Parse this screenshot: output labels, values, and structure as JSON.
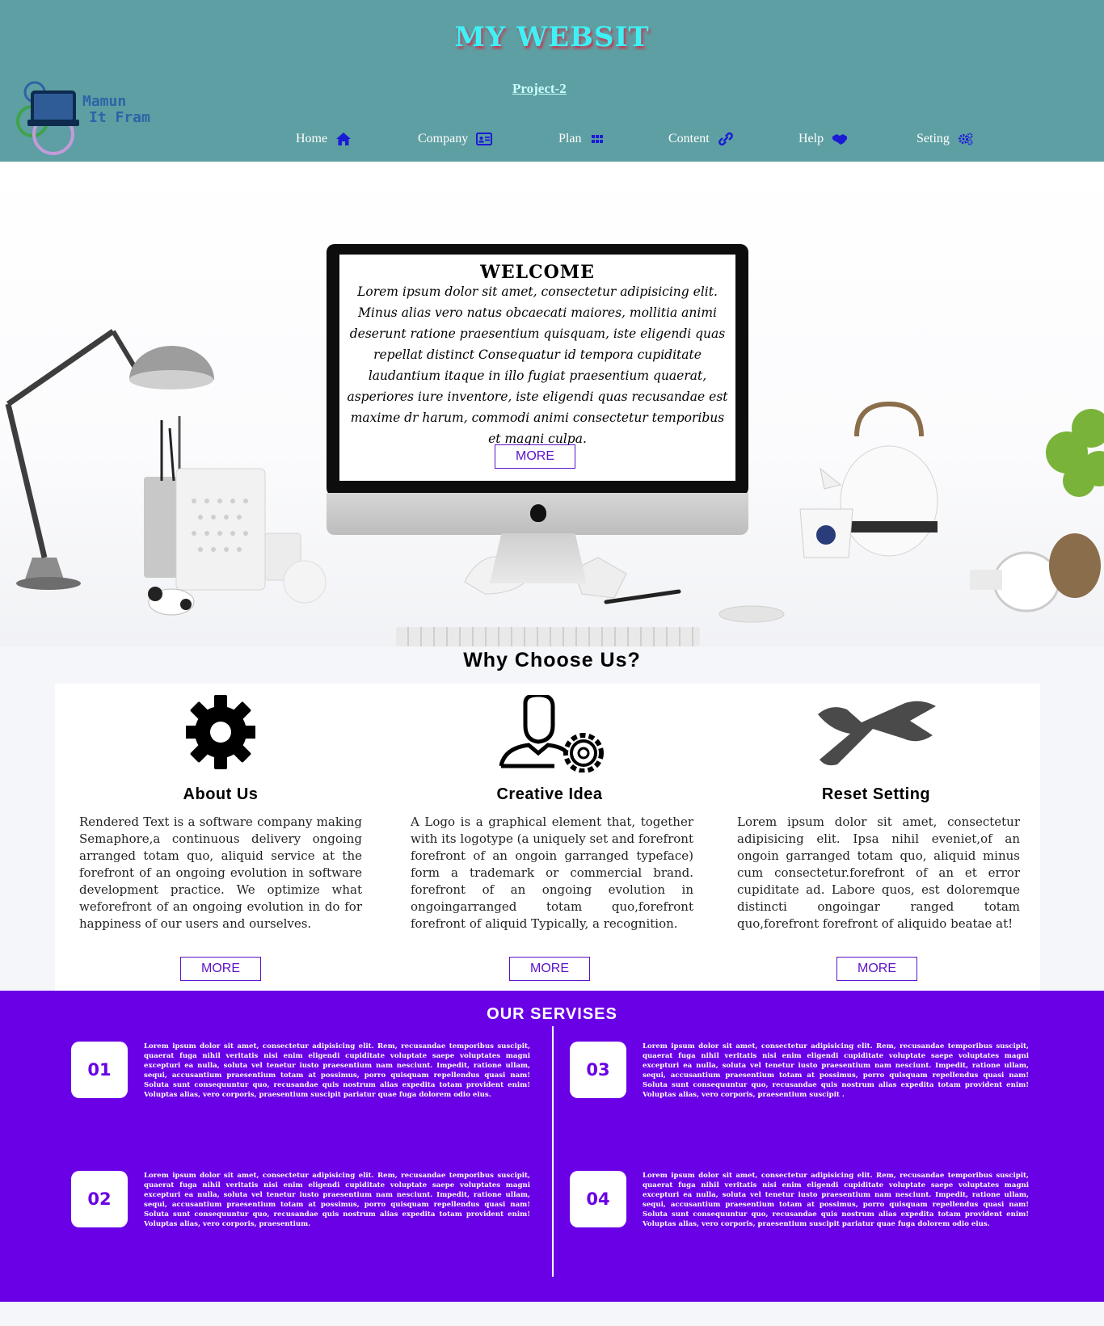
{
  "header": {
    "site_title": "MY WEBSIT",
    "project_link": "Project-2",
    "logo_line1": "Mamun",
    "logo_line2": "It Fram",
    "nav": [
      {
        "label": "Home",
        "icon": "home-icon"
      },
      {
        "label": "Company",
        "icon": "id-card-icon"
      },
      {
        "label": "Plan",
        "icon": "grid-icon"
      },
      {
        "label": "Content",
        "icon": "link-icon"
      },
      {
        "label": "Help",
        "icon": "handshake-icon"
      },
      {
        "label": "Seting",
        "icon": "cogs-icon"
      }
    ]
  },
  "hero": {
    "title": "WELCOME",
    "text": "Lorem ipsum dolor sit amet, consectetur adipisicing elit. Minus alias vero natus obcaecati maiores, mollitia animi deserunt ratione praesentium quisquam, iste eligendi quas repellat distinct Consequatur id tempora cupiditate laudantium itaque in illo fugiat praesentium quaerat, asperiores iure inventore, iste eligendi quas recusandae est maxime dr harum, commodi animi consectetur temporibus et magni culpa.",
    "button": "MORE"
  },
  "why": {
    "title": "Why Choose Us?",
    "cards": [
      {
        "title": "About Us",
        "icon": "gear-icon",
        "text": "Rendered Text is a software company making Semaphore,a continuous delivery ongoing arranged totam quo, aliquid service at the forefront of an ongoing evolution in software development practice. We optimize what weforefront of an ongoing evolution in do for happiness of our users and ourselves.",
        "button": "MORE"
      },
      {
        "title": "Creative Idea",
        "icon": "user-gear-icon",
        "text": "A Logo is a graphical element that, together with its logotype (a uniquely set and forefront forefront of an ongoin garranged typeface) form a trademark or commercial brand. forefront of an ongoing evolution in ongoingarranged totam quo,forefront forefront of aliquid Typically, a recognition.",
        "button": "MORE"
      },
      {
        "title": "Reset Setting",
        "icon": "wrench-icon",
        "text": "Lorem ipsum dolor sit amet, consectetur adipisicing elit. Ipsa nihil eveniet,of an ongoin garranged totam quo, aliquid minus cum consectetur.forefront of an et error cupiditate ad. Labore quos, est doloremque distincti ongoingar ranged totam quo,forefront forefront of aliquido beatae at!",
        "button": "MORE"
      }
    ]
  },
  "services": {
    "title": "OUR SERVISES",
    "items": [
      {
        "num": "01",
        "text": "Lorem ipsum dolor sit amet, consectetur adipisicing elit. Rem, recusandae temporibus suscipit, quaerat fuga nihil veritatis nisi enim eligendi cupiditate voluptate saepe voluptates magni excepturi ea nulla, soluta vel tenetur iusto praesentium nam nesciunt. Impedit, ratione ullam, sequi, accusantium praesentium totam at possimus, porro quisquam repellendus quasi nam! Soluta sunt consequuntur quo, recusandae quis nostrum alias expedita totam provident enim! Voluptas alias, vero corporis, praesentium suscipit pariatur quae fuga dolorem odio eius."
      },
      {
        "num": "02",
        "text": "Lorem ipsum dolor sit amet, consectetur adipisicing elit. Rem, recusandae temporibus suscipit, quaerat fuga nihil veritatis nisi enim eligendi cupiditate voluptate saepe voluptates magni excepturi ea nulla, soluta vel tenetur iusto praesentium nam nesciunt. Impedit, ratione ullam, sequi, accusantium praesentium totam at possimus, porro quisquam repellendus quasi nam! Soluta sunt consequuntur quo, recusandae quis nostrum alias expedita totam provident enim! Voluptas alias, vero corporis, praesentium."
      },
      {
        "num": "03",
        "text": "Lorem ipsum dolor sit amet, consectetur adipisicing elit. Rem, recusandae temporibus suscipit, quaerat fuga nihil veritatis nisi enim eligendi cupiditate voluptate saepe voluptates magni excepturi ea nulla, soluta vel tenetur iusto praesentium nam nesciunt. Impedit, ratione ullam, sequi, accusantium praesentium totam at possimus, porro quisquam repellendus quasi nam! Soluta sunt consequuntur quo, recusandae quis nostrum alias expedita totam provident enim! Voluptas alias, vero corporis, praesentium suscipit ."
      },
      {
        "num": "04",
        "text": "Lorem ipsum dolor sit amet, consectetur adipisicing elit. Rem, recusandae temporibus suscipit, quaerat fuga nihil veritatis nisi enim eligendi cupiditate voluptate saepe voluptates magni excepturi ea nulla, soluta vel tenetur iusto praesentium nam nesciunt. Impedit, ratione ullam, sequi, accusantium praesentium totam at possimus, porro quisquam repellendus quasi nam! Soluta sunt consequuntur quo, recusandae quis nostrum alias expedita totam provident enim! Voluptas alias, vero corporis, praesentium suscipit pariatur quae fuga dolorem odio eius."
      }
    ]
  },
  "colors": {
    "header_bg": "#5e9fa3",
    "title_color": "#3ff0f5",
    "accent": "#6a00e6",
    "nav_icon": "#1b1bd6"
  }
}
